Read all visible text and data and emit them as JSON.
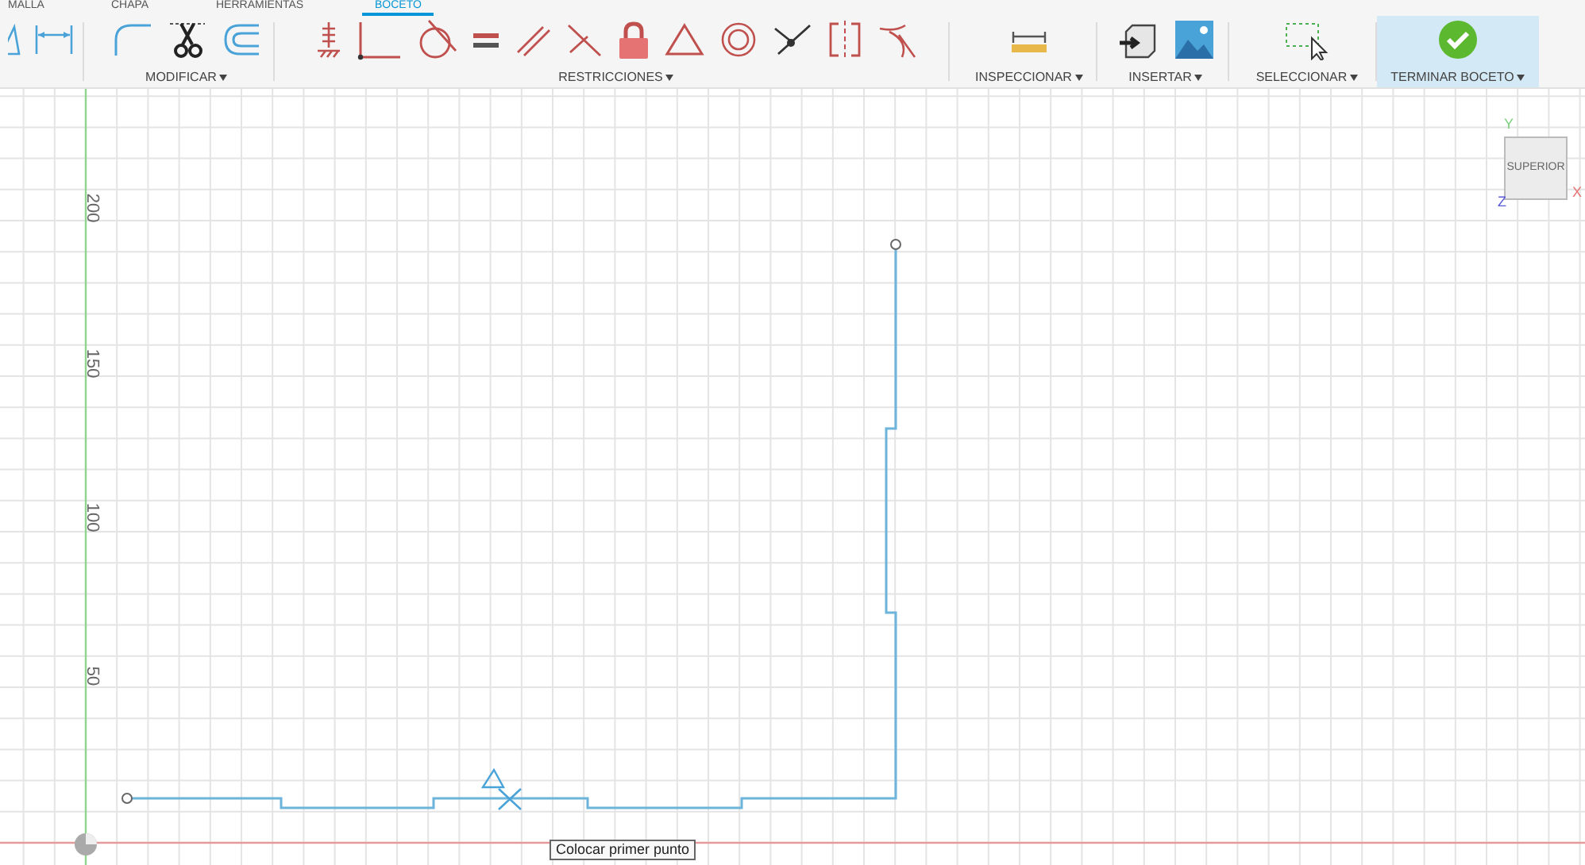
{
  "tabs": [
    {
      "label": "MALLA",
      "selected": false
    },
    {
      "label": "CHAPA",
      "selected": false
    },
    {
      "label": "HERRAMIENTAS",
      "selected": false
    },
    {
      "label": "BOCETO",
      "selected": true
    }
  ],
  "toolbar_groups": [
    {
      "highlighted": false
    },
    {
      "label": "MODIFICAR",
      "highlighted": false
    },
    {
      "label": "RESTRICCIONES",
      "highlighted": false
    },
    {
      "label": "INSPECCIONAR",
      "highlighted": false
    },
    {
      "label": "INSERTAR",
      "highlighted": false
    },
    {
      "label": "SELECCIONAR",
      "highlighted": false
    },
    {
      "label": "TERMINAR BOCETO",
      "highlighted": true
    }
  ],
  "view_cube": {
    "face": "SUPERIOR",
    "axis_x": "X",
    "axis_y": "Y",
    "axis_z": "Z"
  },
  "ruler_labels": [
    "200",
    "150",
    "100",
    "50"
  ],
  "tooltip": "Colocar primer punto"
}
